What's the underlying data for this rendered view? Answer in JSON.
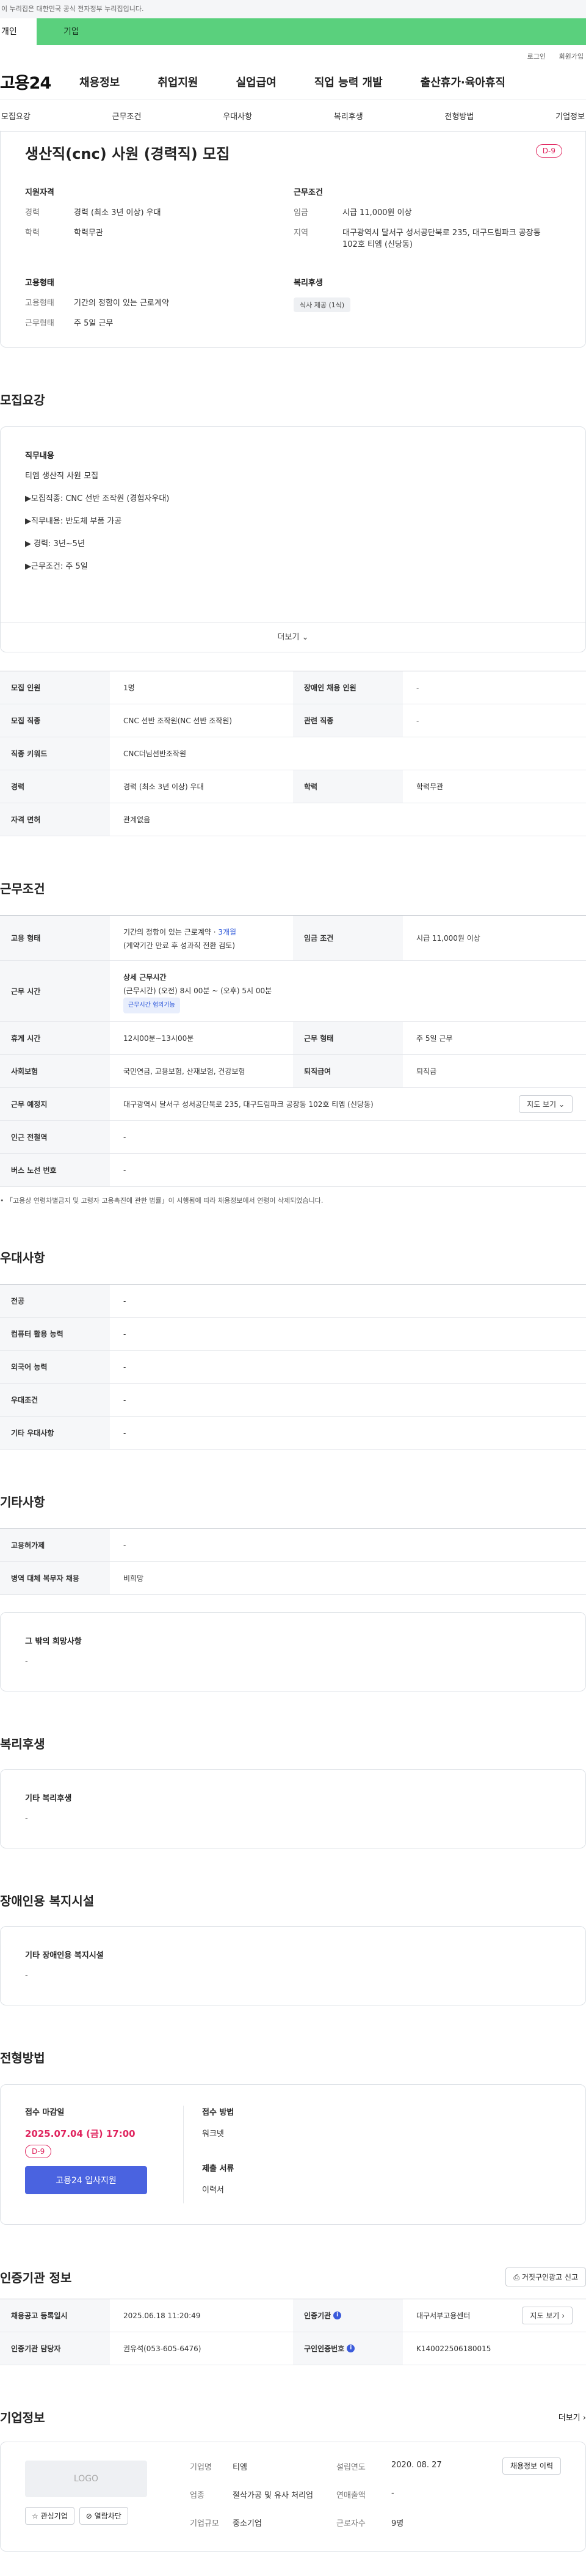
{
  "gov_strip": "이 누리집은 대한민국 공식 전자정부 누리집입니다.",
  "top_tabs": {
    "personal": "개인",
    "business": "기업"
  },
  "util": {
    "login": "로그인",
    "signup": "회원가입"
  },
  "logo": "고용24",
  "gnb": [
    "채용정보",
    "취업지원",
    "실업급여",
    "직업 능력 개발",
    "출산휴가·육아휴직"
  ],
  "subnav": [
    "모집요강",
    "근무조건",
    "우대사항",
    "복리후생",
    "전형방법",
    "기업정보"
  ],
  "job": {
    "title": "생산직(cnc) 사원 (경력직) 모집",
    "dday": "D-9",
    "qual_title": "지원자격",
    "qual": [
      {
        "k": "경력",
        "v": "경력 (최소 3년 이상) 우대"
      },
      {
        "k": "학력",
        "v": "학력무관"
      }
    ],
    "cond_title": "근무조건",
    "cond": [
      {
        "k": "임금",
        "v": "시급 11,000원 이상"
      },
      {
        "k": "지역",
        "v": "대구광역시 달서구 성서공단북로 235, 대구드림파크 공장동 102호 티엠 (신당동)"
      }
    ],
    "emp_title": "고용형태",
    "emp": [
      {
        "k": "고용형태",
        "v": "기간의 정함이 있는 근로계약"
      },
      {
        "k": "근무형태",
        "v": "주 5일 근무"
      }
    ],
    "welfare_title": "복리후생",
    "welfare_chip": "식사 제공 (1식)"
  },
  "recruit": {
    "section": "모집요강",
    "desc_title": "직무내용",
    "desc_lines": [
      "티엠 생산직 사원 모집",
      "▶모집직종: CNC 선반 조작원 (경험자우대)",
      "▶직무내용: 반도체 부품 가공",
      "▶ 경력: 3년~5년",
      "▶근무조건: 주 5일"
    ],
    "more": "더보기",
    "rows": [
      [
        {
          "k": "모집 인원",
          "v": "1명"
        },
        {
          "k": "장애인 채용 인원",
          "v": "-"
        }
      ],
      [
        {
          "k": "모집 직종",
          "v": "CNC 선반 조작원(NC 선반 조작원)"
        },
        {
          "k": "관련 직종",
          "v": "-"
        }
      ],
      [
        {
          "k": "직종 키워드",
          "v": "CNC더님선반조작원"
        }
      ],
      [
        {
          "k": "경력",
          "v": "경력 (최소 3년 이상) 우대"
        },
        {
          "k": "학력",
          "v": "학력무관"
        }
      ],
      [
        {
          "k": "자격 면허",
          "v": "관계없음"
        }
      ]
    ]
  },
  "work": {
    "section": "근무조건",
    "emp_k": "고용 형태",
    "emp_v1": "기간의 정함이 있는 근로계약 · ",
    "emp_v1_link": "3개월",
    "emp_v2": "(계약기간 만료 후 성과직 전환 검토)",
    "wage_k": "임금 조건",
    "wage_v": "시급 11,000원 이상",
    "hours_k": "근무 시간",
    "hours_title": "상세 근무시간",
    "hours_v": "(근무시간) (오전) 8시 00분 ~ (오후) 5시 00분",
    "hours_chip": "근무시간 협의가능",
    "break_k": "휴게 시간",
    "break_v": "12시00분~13시00분",
    "shift_k": "근무 형태",
    "shift_v": "주 5일 근무",
    "ins_k": "사회보험",
    "ins_v": "국민연금, 고용보험, 산재보험, 건강보험",
    "sev_k": "퇴직급여",
    "sev_v": "퇴직금",
    "loc_k": "근무 예정지",
    "loc_v": "대구광역시 달서구 성서공단북로 235, 대구드림파크 공장동 102호 티엠 (신당동)",
    "map_btn": "지도 보기",
    "sub_k": "인근 전철역",
    "sub_v": "-",
    "bus_k": "버스 노선 번호",
    "bus_v": "-",
    "note": "「고용상 연령차별금지 및 고령자 고용촉진에 관한 법률」이 시행됨에 따라 채용정보에서 연령이 삭제되었습니다."
  },
  "pref": {
    "section": "우대사항",
    "rows": [
      {
        "k": "전공",
        "v": "-"
      },
      {
        "k": "컴퓨터 활용 능력",
        "v": "-"
      },
      {
        "k": "외국어 능력",
        "v": "-"
      },
      {
        "k": "우대조건",
        "v": "-"
      },
      {
        "k": "기타 우대사항",
        "v": "-"
      }
    ]
  },
  "etc": {
    "section": "기타사항",
    "rows": [
      {
        "k": "고용허가제",
        "v": "-"
      },
      {
        "k": "병역 대체 복무자 채용",
        "v": "비희망"
      }
    ],
    "wish_title": "그 밖의 희망사항",
    "wish_v": "-"
  },
  "welfare": {
    "section": "복리후생",
    "title": "기타 복리후생",
    "v": "-"
  },
  "disabled": {
    "section": "장애인용 복지시설",
    "title": "기타 장애인용 복지시설",
    "v": "-"
  },
  "process": {
    "section": "전형방법",
    "deadline_title": "접수 마감일",
    "deadline": "2025.07.04 (금) 17:00",
    "dday": "D-9",
    "apply_btn": "고용24 입사지원",
    "method_title": "접수 방법",
    "method_v": "워크넷",
    "docs_title": "제출 서류",
    "docs_v": "이력서"
  },
  "agency": {
    "section": "인증기관 정보",
    "report_btn": "거짓구인광고 신고",
    "rows": [
      [
        {
          "k": "채용공고 등록일시",
          "v": "2025.06.18 11:20:49"
        },
        {
          "k": "인증기관",
          "v": "대구서부고용센터"
        }
      ],
      [
        {
          "k": "인증기관 담당자",
          "v": "권유석(053-605-6476)"
        },
        {
          "k": "구인인증번호",
          "v": "K140022506180015"
        }
      ]
    ],
    "map_btn": "지도 보기"
  },
  "company": {
    "section": "기업정보",
    "more": "더보기",
    "logo": "LOGO",
    "fav_btn": "관심기업",
    "block_btn": "열람차단",
    "fields": [
      {
        "k": "기업명",
        "v": "티엠"
      },
      {
        "k": "설립연도",
        "v": "2020. 08. 27"
      },
      {
        "k": "업종",
        "v": "절삭가공 및 유사 처리업"
      },
      {
        "k": "연매출액",
        "v": "-"
      },
      {
        "k": "기업규모",
        "v": "중소기업"
      },
      {
        "k": "근로자수",
        "v": "9명"
      }
    ],
    "history_btn": "채용정보 이력"
  }
}
